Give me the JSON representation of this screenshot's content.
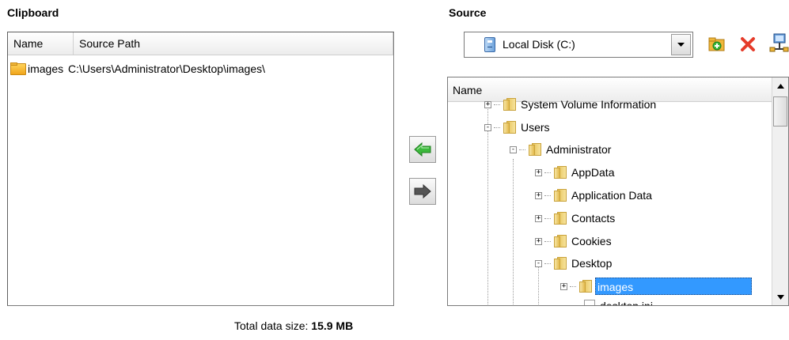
{
  "clipboard": {
    "title": "Clipboard",
    "columns": [
      "Name",
      "Source Path"
    ],
    "rows": [
      {
        "name": "images",
        "path": "C:\\Users\\Administrator\\Desktop\\images\\"
      }
    ]
  },
  "source": {
    "title": "Source",
    "drive": "Local Disk (C:)",
    "tree_header": "Name",
    "nodes": [
      {
        "label": "System Volume Information",
        "expander": "+"
      },
      {
        "label": "Users",
        "expander": "-"
      },
      {
        "label": "Administrator",
        "expander": "-"
      },
      {
        "label": "AppData",
        "expander": "+"
      },
      {
        "label": "Application Data",
        "expander": "+"
      },
      {
        "label": "Contacts",
        "expander": "+"
      },
      {
        "label": "Cookies",
        "expander": "+"
      },
      {
        "label": "Desktop",
        "expander": "-"
      },
      {
        "label": "images",
        "expander": "+"
      },
      {
        "label": "desktop.ini",
        "expander": ""
      }
    ]
  },
  "footer": {
    "label": "Total data size:",
    "value": "15.9 MB"
  },
  "colors": {
    "selection": "#3399ff",
    "add_arrow": "#3cb93c",
    "remove_arrow": "#555555",
    "delete_icon": "#e53b2a"
  }
}
